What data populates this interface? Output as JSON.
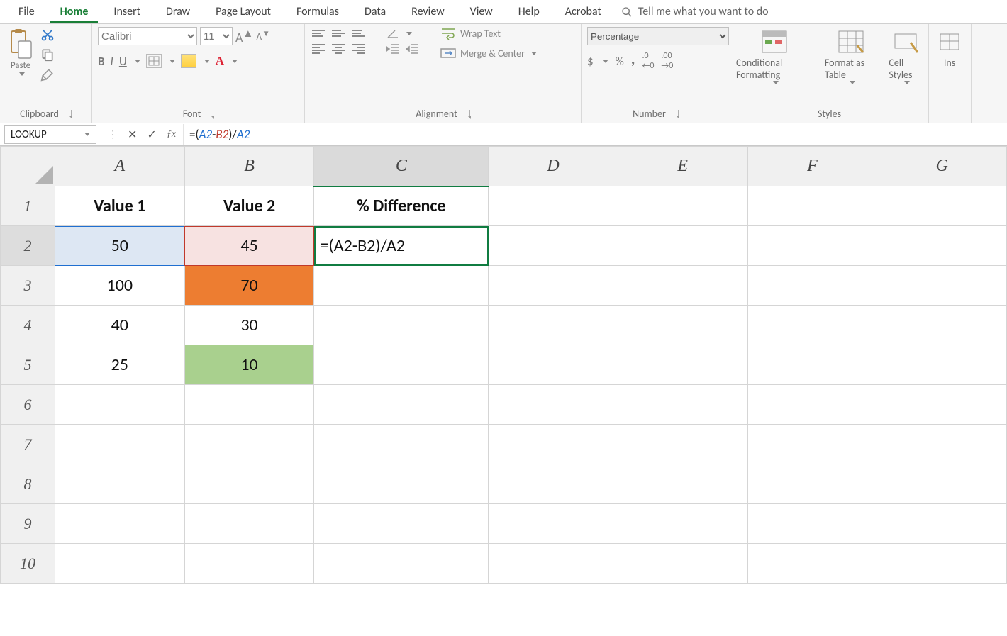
{
  "ribbon_tabs": {
    "items": [
      "File",
      "Home",
      "Insert",
      "Draw",
      "Page Layout",
      "Formulas",
      "Data",
      "Review",
      "View",
      "Help",
      "Acrobat"
    ],
    "active": "Home",
    "tell_me": "Tell me what you want to do"
  },
  "clipboard_group": {
    "label": "Clipboard",
    "paste": "Paste"
  },
  "font_group": {
    "label": "Font",
    "font_name": "Calibri",
    "font_size": "11",
    "bold": "B",
    "italic": "I",
    "underline": "U"
  },
  "alignment_group": {
    "label": "Alignment",
    "wrap": "Wrap Text",
    "merge": "Merge & Center"
  },
  "number_group": {
    "label": "Number",
    "format": "Percentage",
    "currency": "$",
    "percent": "%",
    "comma": ","
  },
  "styles_group": {
    "label": "Styles",
    "cond": "Conditional Formatting",
    "table": "Format as Table",
    "cell": "Cell Styles",
    "ins": "Ins"
  },
  "fx_bar": {
    "name_box": "LOOKUP",
    "formula_prefix": "=(",
    "formula_ref1": "A2",
    "formula_dash": "-",
    "formula_ref2": "B2",
    "formula_suffix": ")/",
    "formula_ref3": "A2"
  },
  "grid": {
    "columns": [
      "A",
      "B",
      "C",
      "D",
      "E",
      "F",
      "G"
    ],
    "rows": [
      "1",
      "2",
      "3",
      "4",
      "5",
      "6",
      "7",
      "8",
      "9",
      "10"
    ],
    "headers": {
      "A": "Value 1",
      "B": "Value 2",
      "C": "% Difference"
    },
    "data": {
      "A2": "50",
      "B2": "45",
      "C2": "=(A2-B2)/A2",
      "A3": "100",
      "B3": "70",
      "A4": "40",
      "B4": "30",
      "A5": "25",
      "B5": "10"
    },
    "active_cell": "C2",
    "active_row": "2",
    "ref_highlights": {
      "A2": "blue",
      "B2": "red"
    },
    "cell_fills": {
      "B3": "orange",
      "B5": "green"
    }
  }
}
